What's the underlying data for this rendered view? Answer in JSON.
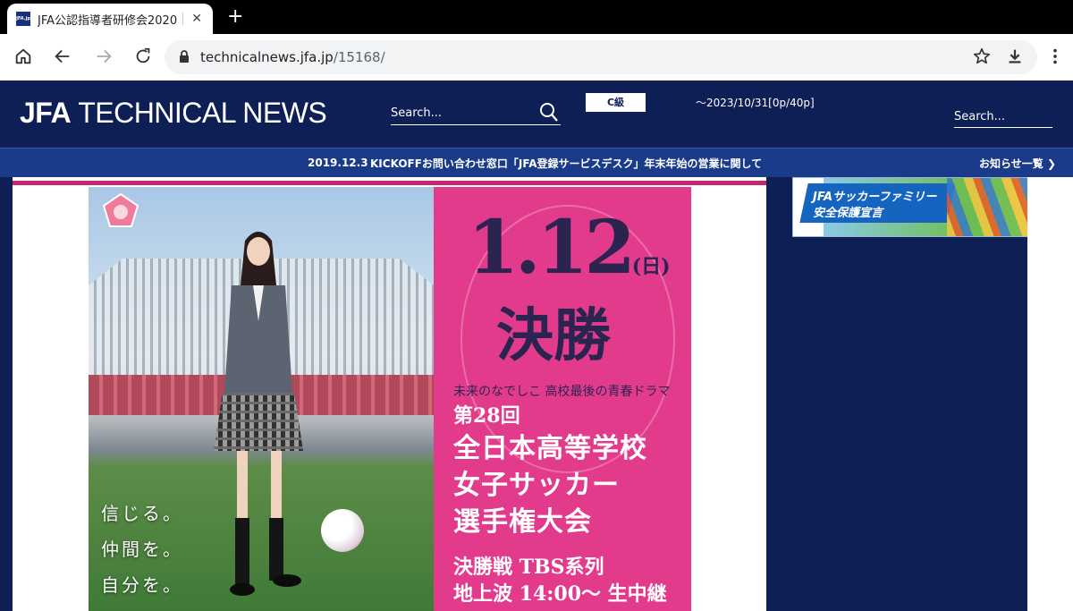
{
  "browser": {
    "tab_title": "JFA公認指導者研修会2020",
    "favicon_text": "JFA.jp",
    "url_host": "technicalnews.jfa.jp",
    "url_path": "/15168/"
  },
  "header": {
    "logo_bold": "JFA",
    "logo_rest": "TECHNICAL NEWS",
    "search_placeholder": "Search...",
    "grade": "C級",
    "date_range": "〜2023/10/31[0p/40p]",
    "search2_placeholder": "Search..."
  },
  "newsbar": {
    "date": "2019.12.3",
    "text": "KICKOFFお問い合わせ窓口「JFA登録サービスデスク」年末年始の営業に関して",
    "more": "お知らせ一覧 ❯"
  },
  "poster": {
    "date": "1.12",
    "weekday": "(日)",
    "kessho": "決勝",
    "tagline": "未来のなでしこ 高校最後の青春ドラマ",
    "title_1": "第28回",
    "title_2": "全日本高等学校",
    "title_3": "女子サッカー",
    "title_4": "選手権大会",
    "broadcast_1": "決勝戦 TBS系列",
    "broadcast_2": "地上波 14:00〜 生中継",
    "vert_1": "信じる。",
    "vert_2": "仲間を。",
    "vert_3": "自分を。"
  },
  "sidebar": {
    "banner_line1": "JFAサッカーファミリー",
    "banner_line2": "安全保護宣言"
  },
  "colors": {
    "navy": "#0d1f55",
    "newsbar": "#1a3a8a",
    "pink": "#e33b8c",
    "accent": "#c8266b"
  },
  "icons": [
    "home-icon",
    "back-icon",
    "forward-icon",
    "reload-icon",
    "lock-icon",
    "star-icon",
    "download-icon",
    "menu-icon",
    "search-icon",
    "close-icon",
    "plus-icon"
  ]
}
